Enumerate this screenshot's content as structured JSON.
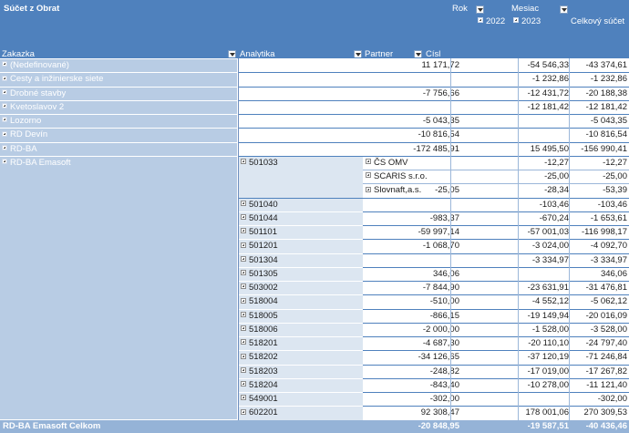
{
  "header": {
    "measure": "Súčet z Obrat",
    "col_fields": {
      "year": "Rok",
      "month": "Mesiac"
    },
    "years": [
      "2022",
      "2023"
    ],
    "grand_total": "Celkový súčet",
    "row_fields": [
      "Zakazka",
      "Analytika",
      "Partner",
      "Císl"
    ]
  },
  "simple_rows": [
    {
      "zakazka": "(Nedefinované)",
      "v2022": "11 171,72",
      "v2023": "-54 546,33",
      "total": "-43 374,61"
    },
    {
      "zakazka": "Cesty a inžinierske siete",
      "v2022": "",
      "v2023": "-1 232,86",
      "total": "-1 232,86"
    },
    {
      "zakazka": "Drobné stavby",
      "v2022": "-7 756,66",
      "v2023": "-12 431,72",
      "total": "-20 188,38"
    },
    {
      "zakazka": "Kvetoslavov 2",
      "v2022": "",
      "v2023": "-12 181,42",
      "total": "-12 181,42"
    },
    {
      "zakazka": "Lozorno",
      "v2022": "-5 043,35",
      "v2023": "",
      "total": "-5 043,35"
    },
    {
      "zakazka": "RD Devín",
      "v2022": "-10 816,54",
      "v2023": "",
      "total": "-10 816,54"
    },
    {
      "zakazka": "RD-BA",
      "v2022": "-172 485,91",
      "v2023": "15 495,50",
      "total": "-156 990,41"
    }
  ],
  "emasoft": {
    "zakazka": "RD-BA Emasoft",
    "partner_rows": [
      {
        "analytika": "501033",
        "partner": "ČS OMV",
        "v2022": "",
        "v2023": "-12,27",
        "total": "-12,27"
      },
      {
        "analytika": "",
        "partner": "SCARIS s.r.o.",
        "v2022": "",
        "v2023": "-25,00",
        "total": "-25,00"
      },
      {
        "analytika": "",
        "partner": "Slovnaft,a.s.",
        "v2022": "-25,05",
        "v2023": "-28,34",
        "total": "-53,39"
      }
    ],
    "analytika_rows": [
      {
        "analytika": "501040",
        "v2022": "",
        "v2023": "-103,46",
        "total": "-103,46"
      },
      {
        "analytika": "501044",
        "v2022": "-983,37",
        "v2023": "-670,24",
        "total": "-1 653,61"
      },
      {
        "analytika": "501101",
        "v2022": "-59 997,14",
        "v2023": "-57 001,03",
        "total": "-116 998,17"
      },
      {
        "analytika": "501201",
        "v2022": "-1 068,70",
        "v2023": "-3 024,00",
        "total": "-4 092,70"
      },
      {
        "analytika": "501304",
        "v2022": "",
        "v2023": "-3 334,97",
        "total": "-3 334,97"
      },
      {
        "analytika": "501305",
        "v2022": "346,06",
        "v2023": "",
        "total": "346,06"
      },
      {
        "analytika": "503002",
        "v2022": "-7 844,90",
        "v2023": "-23 631,91",
        "total": "-31 476,81"
      },
      {
        "analytika": "518004",
        "v2022": "-510,00",
        "v2023": "-4 552,12",
        "total": "-5 062,12"
      },
      {
        "analytika": "518005",
        "v2022": "-866,15",
        "v2023": "-19 149,94",
        "total": "-20 016,09"
      },
      {
        "analytika": "518006",
        "v2022": "-2 000,00",
        "v2023": "-1 528,00",
        "total": "-3 528,00"
      },
      {
        "analytika": "518201",
        "v2022": "-4 687,30",
        "v2023": "-20 110,10",
        "total": "-24 797,40"
      },
      {
        "analytika": "518202",
        "v2022": "-34 126,65",
        "v2023": "-37 120,19",
        "total": "-71 246,84"
      },
      {
        "analytika": "518203",
        "v2022": "-248,82",
        "v2023": "-17 019,00",
        "total": "-17 267,82"
      },
      {
        "analytika": "518204",
        "v2022": "-843,40",
        "v2023": "-10 278,00",
        "total": "-11 121,40"
      },
      {
        "analytika": "549001",
        "v2022": "-302,00",
        "v2023": "",
        "total": "-302,00"
      },
      {
        "analytika": "602201",
        "v2022": "92 308,47",
        "v2023": "178 001,06",
        "total": "270 309,53"
      }
    ],
    "total": {
      "label": "RD-BA Emasoft Celkom",
      "v2022": "-20 848,95",
      "v2023": "-19 587,51",
      "total": "-40 436,46"
    }
  }
}
